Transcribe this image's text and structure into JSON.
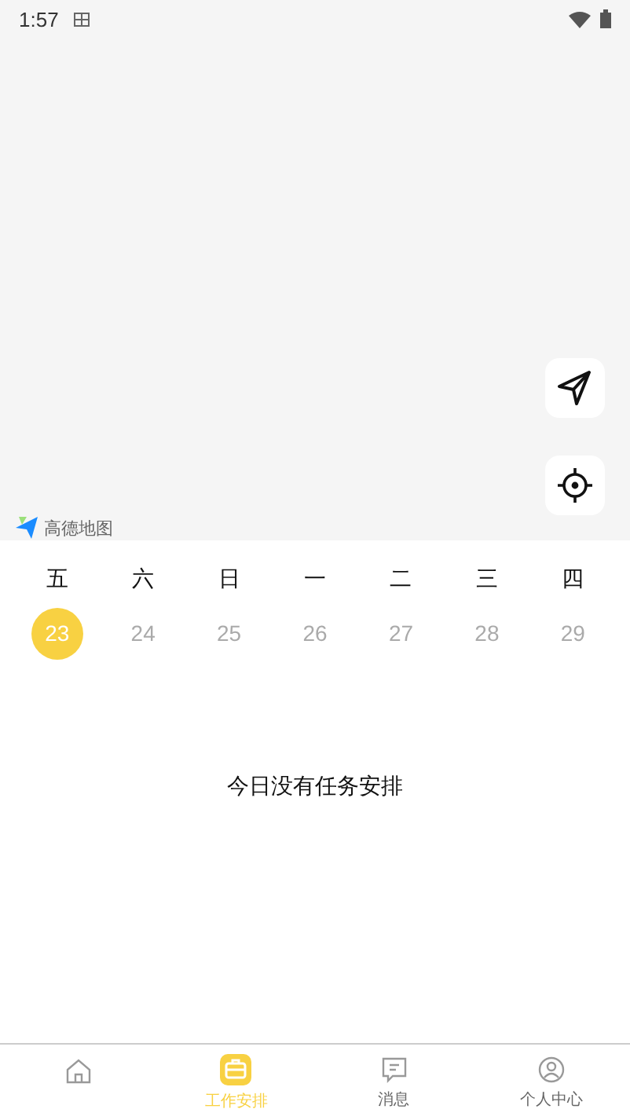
{
  "status_bar": {
    "time": "1:57"
  },
  "map": {
    "logo_text": "高德地图"
  },
  "calendar": {
    "weekdays": [
      "五",
      "六",
      "日",
      "一",
      "二",
      "三",
      "四"
    ],
    "days": [
      {
        "label": "23",
        "selected": true
      },
      {
        "label": "24",
        "selected": false
      },
      {
        "label": "25",
        "selected": false
      },
      {
        "label": "26",
        "selected": false
      },
      {
        "label": "27",
        "selected": false
      },
      {
        "label": "28",
        "selected": false
      },
      {
        "label": "29",
        "selected": false
      }
    ]
  },
  "empty_message": "今日没有任务安排",
  "tab_bar": [
    {
      "kind": "home",
      "selected": false
    },
    {
      "kind": "work",
      "label": "工作安排",
      "selected": true
    },
    {
      "kind": "message",
      "label": "消息",
      "selected": false
    },
    {
      "kind": "profile",
      "label": "个人中心",
      "selected": false
    }
  ]
}
